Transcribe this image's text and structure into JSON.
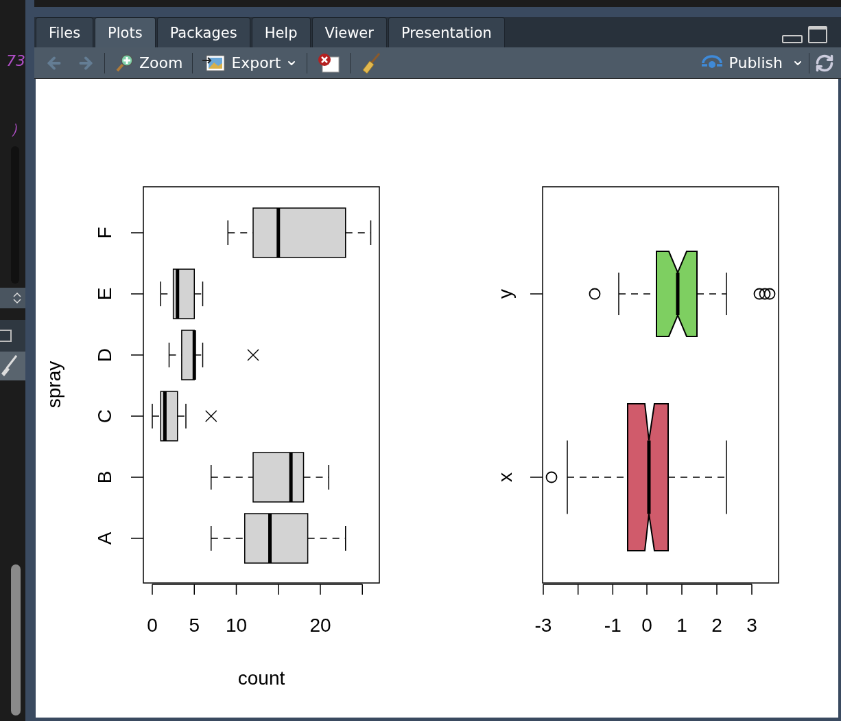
{
  "left_pane": {
    "texts": [
      "73",
      "）"
    ]
  },
  "tabs": [
    {
      "label": "Files",
      "selected": false
    },
    {
      "label": "Plots",
      "selected": true
    },
    {
      "label": "Packages",
      "selected": false
    },
    {
      "label": "Help",
      "selected": false
    },
    {
      "label": "Viewer",
      "selected": false
    },
    {
      "label": "Presentation",
      "selected": false
    }
  ],
  "toolbar": {
    "back": {
      "disabled": true
    },
    "forward": {
      "disabled": true
    },
    "zoom": "Zoom",
    "export": "Export",
    "publish": "Publish"
  },
  "plots": [
    {
      "kind": "boxplot",
      "ylabel": "spray",
      "categories": [
        "F",
        "E",
        "D",
        "C",
        "B",
        "A"
      ],
      "xticks": [
        "0",
        "5",
        "10",
        "20"
      ],
      "xlabel": "count"
    },
    {
      "kind": "notched-boxplot",
      "categories": [
        "y",
        "x"
      ],
      "xticks": [
        "-3",
        "-1",
        "0",
        "1",
        "2",
        "3"
      ]
    }
  ]
}
